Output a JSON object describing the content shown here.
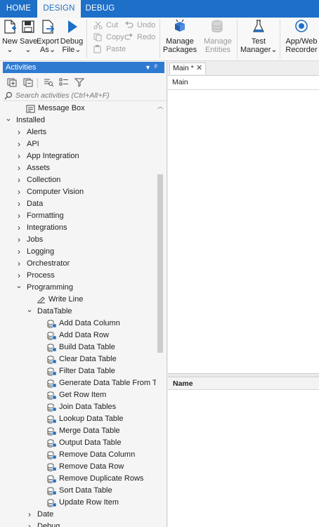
{
  "tabs": [
    {
      "label": "HOME",
      "active": false
    },
    {
      "label": "DESIGN",
      "active": true
    },
    {
      "label": "DEBUG",
      "active": false
    }
  ],
  "ribbon": {
    "new": "New",
    "save": "Save",
    "export": "Export",
    "export_2": "As",
    "debug": "Debug",
    "debug_2": "File",
    "cut": "Cut",
    "copy": "Copy",
    "paste": "Paste",
    "undo": "Undo",
    "redo": "Redo",
    "manage_packages": "Manage",
    "manage_packages_2": "Packages",
    "manage_entities": "Manage",
    "manage_entities_2": "Entities",
    "test_manager": "Test",
    "test_manager_2": "Manager",
    "recorder": "App/Web",
    "recorder_2": "Recorder"
  },
  "activities": {
    "title": "Activities",
    "search_placeholder": "Search activities (Ctrl+Alt+F)",
    "items": [
      {
        "label": "Message Box",
        "level": 1,
        "kind": "leaf",
        "icon": "message-box-icon"
      },
      {
        "label": "Installed",
        "level": 0,
        "kind": "expanded"
      },
      {
        "label": "Alerts",
        "level": 1,
        "kind": "collapsed"
      },
      {
        "label": "API",
        "level": 1,
        "kind": "collapsed"
      },
      {
        "label": "App Integration",
        "level": 1,
        "kind": "collapsed"
      },
      {
        "label": "Assets",
        "level": 1,
        "kind": "collapsed"
      },
      {
        "label": "Collection",
        "level": 1,
        "kind": "collapsed"
      },
      {
        "label": "Computer Vision",
        "level": 1,
        "kind": "collapsed"
      },
      {
        "label": "Data",
        "level": 1,
        "kind": "collapsed"
      },
      {
        "label": "Formatting",
        "level": 1,
        "kind": "collapsed"
      },
      {
        "label": "Integrations",
        "level": 1,
        "kind": "collapsed"
      },
      {
        "label": "Jobs",
        "level": 1,
        "kind": "collapsed"
      },
      {
        "label": "Logging",
        "level": 1,
        "kind": "collapsed"
      },
      {
        "label": "Orchestrator",
        "level": 1,
        "kind": "collapsed"
      },
      {
        "label": "Process",
        "level": 1,
        "kind": "collapsed"
      },
      {
        "label": "Programming",
        "level": 1,
        "kind": "expanded"
      },
      {
        "label": "Write Line",
        "level": 2,
        "kind": "leaf",
        "icon": "write-line-icon"
      },
      {
        "label": "DataTable",
        "level": 2,
        "kind": "expanded"
      },
      {
        "label": "Add Data Column",
        "level": 3,
        "kind": "leaf",
        "icon": "datatable-icon"
      },
      {
        "label": "Add Data Row",
        "level": 3,
        "kind": "leaf",
        "icon": "datatable-icon"
      },
      {
        "label": "Build Data Table",
        "level": 3,
        "kind": "leaf",
        "icon": "datatable-icon"
      },
      {
        "label": "Clear Data Table",
        "level": 3,
        "kind": "leaf",
        "icon": "datatable-icon"
      },
      {
        "label": "Filter Data Table",
        "level": 3,
        "kind": "leaf",
        "icon": "datatable-icon"
      },
      {
        "label": "Generate Data Table From Text",
        "level": 3,
        "kind": "leaf",
        "icon": "datatable-icon"
      },
      {
        "label": "Get Row Item",
        "level": 3,
        "kind": "leaf",
        "icon": "datatable-icon"
      },
      {
        "label": "Join Data Tables",
        "level": 3,
        "kind": "leaf",
        "icon": "datatable-icon"
      },
      {
        "label": "Lookup Data Table",
        "level": 3,
        "kind": "leaf",
        "icon": "datatable-icon"
      },
      {
        "label": "Merge Data Table",
        "level": 3,
        "kind": "leaf",
        "icon": "datatable-icon"
      },
      {
        "label": "Output Data Table",
        "level": 3,
        "kind": "leaf",
        "icon": "datatable-icon"
      },
      {
        "label": "Remove Data Column",
        "level": 3,
        "kind": "leaf",
        "icon": "datatable-icon"
      },
      {
        "label": "Remove Data Row",
        "level": 3,
        "kind": "leaf",
        "icon": "datatable-icon"
      },
      {
        "label": "Remove Duplicate Rows",
        "level": 3,
        "kind": "leaf",
        "icon": "datatable-icon"
      },
      {
        "label": "Sort Data Table",
        "level": 3,
        "kind": "leaf",
        "icon": "datatable-icon"
      },
      {
        "label": "Update Row Item",
        "level": 3,
        "kind": "leaf",
        "icon": "datatable-icon"
      },
      {
        "label": "Date",
        "level": 2,
        "kind": "collapsed"
      },
      {
        "label": "Debug",
        "level": 2,
        "kind": "collapsed"
      }
    ]
  },
  "designer": {
    "tab_label": "Main *",
    "breadcrumb": "Main"
  },
  "variables": {
    "header": "Name"
  },
  "colors": {
    "accent": "#1d6fc7",
    "panel_header": "#2f7ad1"
  }
}
